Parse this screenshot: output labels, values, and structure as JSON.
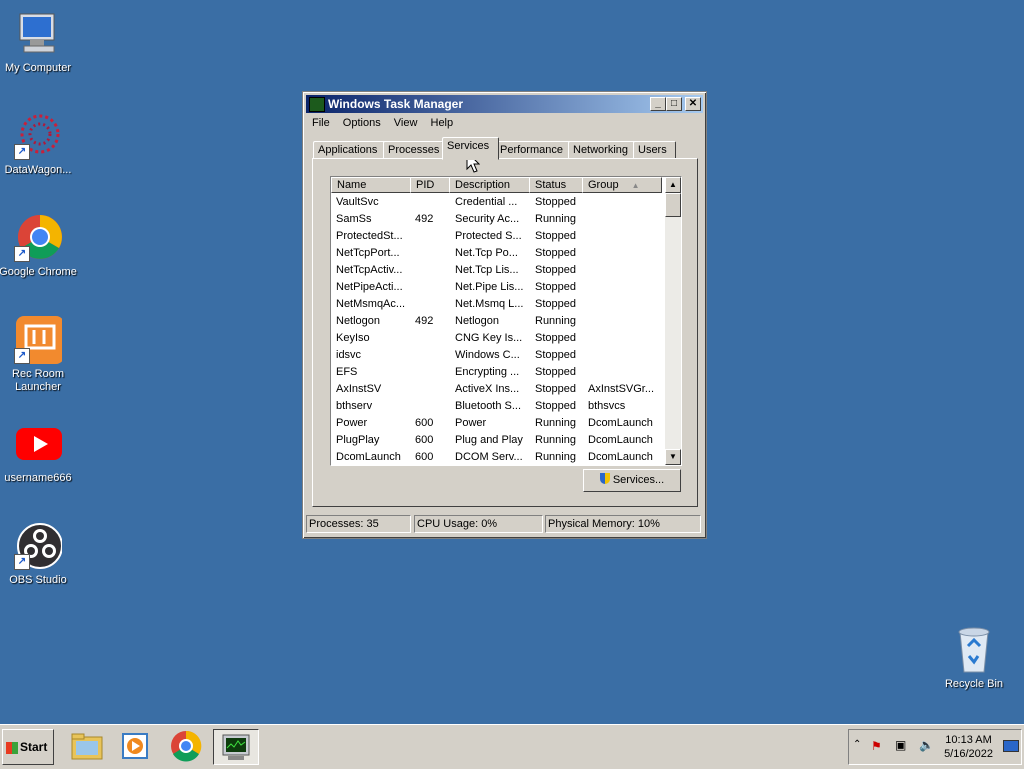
{
  "desktop": {
    "icons": [
      {
        "label": "My Computer"
      },
      {
        "label": "DataWagon..."
      },
      {
        "label": "Google Chrome"
      },
      {
        "label": "Rec Room Launcher"
      },
      {
        "label": "username666"
      },
      {
        "label": "OBS Studio"
      },
      {
        "label": "Recycle Bin"
      }
    ]
  },
  "window": {
    "title": "Windows Task Manager",
    "menu": [
      "File",
      "Options",
      "View",
      "Help"
    ],
    "tabs": [
      "Applications",
      "Processes",
      "Services",
      "Performance",
      "Networking",
      "Users"
    ],
    "active_tab": "Services",
    "columns": [
      "Name",
      "PID",
      "Description",
      "Status",
      "Group"
    ],
    "rows": [
      {
        "name": "VaultSvc",
        "pid": "",
        "desc": "Credential ...",
        "status": "Stopped",
        "group": ""
      },
      {
        "name": "SamSs",
        "pid": "492",
        "desc": "Security Ac...",
        "status": "Running",
        "group": ""
      },
      {
        "name": "ProtectedSt...",
        "pid": "",
        "desc": "Protected S...",
        "status": "Stopped",
        "group": ""
      },
      {
        "name": "NetTcpPort...",
        "pid": "",
        "desc": "Net.Tcp Po...",
        "status": "Stopped",
        "group": ""
      },
      {
        "name": "NetTcpActiv...",
        "pid": "",
        "desc": "Net.Tcp Lis...",
        "status": "Stopped",
        "group": ""
      },
      {
        "name": "NetPipeActi...",
        "pid": "",
        "desc": "Net.Pipe Lis...",
        "status": "Stopped",
        "group": ""
      },
      {
        "name": "NetMsmqAc...",
        "pid": "",
        "desc": "Net.Msmq L...",
        "status": "Stopped",
        "group": ""
      },
      {
        "name": "Netlogon",
        "pid": "492",
        "desc": "Netlogon",
        "status": "Running",
        "group": ""
      },
      {
        "name": "KeyIso",
        "pid": "",
        "desc": "CNG Key Is...",
        "status": "Stopped",
        "group": ""
      },
      {
        "name": "idsvc",
        "pid": "",
        "desc": "Windows C...",
        "status": "Stopped",
        "group": ""
      },
      {
        "name": "EFS",
        "pid": "",
        "desc": "Encrypting ...",
        "status": "Stopped",
        "group": ""
      },
      {
        "name": "AxInstSV",
        "pid": "",
        "desc": "ActiveX Ins...",
        "status": "Stopped",
        "group": "AxInstSVGr..."
      },
      {
        "name": "bthserv",
        "pid": "",
        "desc": "Bluetooth S...",
        "status": "Stopped",
        "group": "bthsvcs"
      },
      {
        "name": "Power",
        "pid": "600",
        "desc": "Power",
        "status": "Running",
        "group": "DcomLaunch"
      },
      {
        "name": "PlugPlay",
        "pid": "600",
        "desc": "Plug and Play",
        "status": "Running",
        "group": "DcomLaunch"
      },
      {
        "name": "DcomLaunch",
        "pid": "600",
        "desc": "DCOM Serv...",
        "status": "Running",
        "group": "DcomLaunch"
      }
    ],
    "services_button": "Services...",
    "status": {
      "processes": "Processes: 35",
      "cpu": "CPU Usage: 0%",
      "memory": "Physical Memory: 10%"
    }
  },
  "taskbar": {
    "start_label": "Start",
    "clock_time": "10:13 AM",
    "clock_date": "5/16/2022"
  }
}
